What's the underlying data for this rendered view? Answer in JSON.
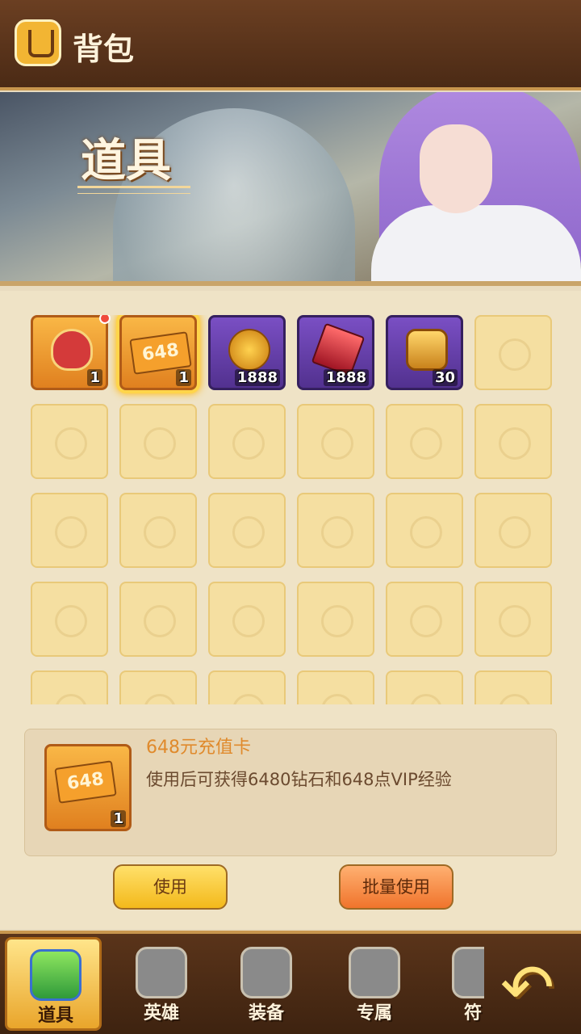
{
  "header": {
    "title": "背包",
    "icon": "bag-icon"
  },
  "banner": {
    "label": "道具"
  },
  "grid": {
    "items": [
      {
        "name": "red-pouch",
        "count": "1",
        "style": "orange",
        "badge": true,
        "glyph": "pouch"
      },
      {
        "name": "recharge-card-648",
        "count": "1",
        "style": "orange",
        "selected": true,
        "glyph": "card",
        "card_text": "648"
      },
      {
        "name": "gold-gem",
        "count": "1888",
        "style": "purple",
        "glyph": "gold"
      },
      {
        "name": "red-crystal",
        "count": "1888",
        "style": "purple",
        "glyph": "crystal"
      },
      {
        "name": "golden-medal",
        "count": "30",
        "style": "purple",
        "glyph": "medal"
      }
    ]
  },
  "detail": {
    "name": "648元充值卡",
    "description": "使用后可获得6480钻石和648点VIP经验",
    "count": "1",
    "card_text": "648"
  },
  "buttons": {
    "use": "使用",
    "batch_use": "批量使用"
  },
  "nav": {
    "tabs": [
      {
        "label": "道具",
        "icon": "gem-icon",
        "active": true
      },
      {
        "label": "英雄",
        "icon": "helmet-icon",
        "active": false
      },
      {
        "label": "装备",
        "icon": "armor-icon",
        "active": false
      },
      {
        "label": "专属",
        "icon": "amulet-icon",
        "active": false
      },
      {
        "label": "符",
        "icon": "rune-icon",
        "active": false
      }
    ]
  }
}
